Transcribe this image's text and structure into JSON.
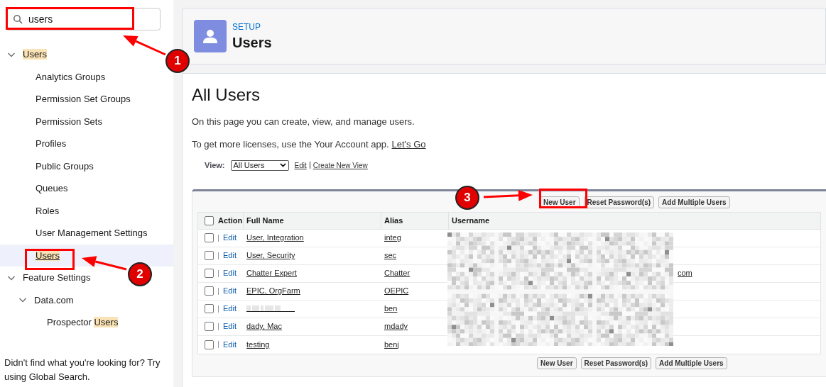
{
  "search": {
    "value": "users"
  },
  "tree": [
    {
      "parts": [
        {
          "text": "Users",
          "match": true
        }
      ],
      "expanded": true,
      "selected": false,
      "children": [
        {
          "parts": [
            {
              "text": "Analytics Groups",
              "match": false
            }
          ],
          "selected": false
        },
        {
          "parts": [
            {
              "text": "Permission Set Groups",
              "match": false
            }
          ],
          "selected": false
        },
        {
          "parts": [
            {
              "text": "Permission Sets",
              "match": false
            }
          ],
          "selected": false
        },
        {
          "parts": [
            {
              "text": "Profiles",
              "match": false
            }
          ],
          "selected": false
        },
        {
          "parts": [
            {
              "text": "Public Groups",
              "match": false
            }
          ],
          "selected": false
        },
        {
          "parts": [
            {
              "text": "Queues",
              "match": false
            }
          ],
          "selected": false
        },
        {
          "parts": [
            {
              "text": "Roles",
              "match": false
            }
          ],
          "selected": false
        },
        {
          "parts": [
            {
              "text": "User Management Settings",
              "match": false
            }
          ],
          "selected": false
        },
        {
          "parts": [
            {
              "text": "Users",
              "match": true
            }
          ],
          "selected": true
        }
      ]
    },
    {
      "parts": [
        {
          "text": "Feature Settings",
          "match": false
        }
      ],
      "expanded": true,
      "selected": false,
      "children": [
        {
          "parts": [
            {
              "text": "Data.com",
              "match": false
            }
          ],
          "expanded": true,
          "selected": false,
          "children": [
            {
              "parts": [
                {
                  "text": "Prospector ",
                  "match": false
                },
                {
                  "text": "Users",
                  "match": true
                }
              ],
              "selected": false
            }
          ]
        }
      ]
    }
  ],
  "sidebar_footer": "Didn't find what you're looking for? Try using Global Search.",
  "header": {
    "eyebrow": "SETUP",
    "title": "Users"
  },
  "page": {
    "title": "All Users",
    "intro": "On this page you can create, view, and manage users.",
    "licenses_text": "To get more licenses, use the Your Account app.",
    "licenses_link": "Let's Go"
  },
  "view": {
    "label": "View:",
    "value": "All Users",
    "links": [
      "Edit",
      "Create New View"
    ]
  },
  "buttons_top": [
    "New User",
    "Reset Password(s)",
    "Add Multiple Users"
  ],
  "buttons_bottom": [
    "New User",
    "Reset Password(s)",
    "Add Multiple Users"
  ],
  "table": {
    "columns": [
      "Action",
      "Full Name",
      "Alias",
      "Username"
    ],
    "select_all_checked": false,
    "rows": [
      {
        "checked": false,
        "action": "Edit",
        "full_name": "User, Integration",
        "alias": "integ"
      },
      {
        "checked": false,
        "action": "Edit",
        "full_name": "User, Security",
        "alias": "sec"
      },
      {
        "checked": false,
        "action": "Edit",
        "full_name": "Chatter Expert",
        "alias": "Chatter",
        "username": "com"
      },
      {
        "checked": false,
        "action": "Edit",
        "full_name": "EPIC, OrgFarm",
        "alias": "OEPIC"
      },
      {
        "checked": false,
        "action": "Edit",
        "full_name_redacted": true,
        "alias": "ben"
      },
      {
        "checked": false,
        "action": "Edit",
        "full_name": "dady, Mac",
        "alias": "mdady"
      },
      {
        "checked": false,
        "action": "Edit",
        "full_name": "testing",
        "alias": "benj"
      }
    ]
  },
  "annotations": [
    {
      "number": "1"
    },
    {
      "number": "2"
    },
    {
      "number": "3"
    }
  ]
}
